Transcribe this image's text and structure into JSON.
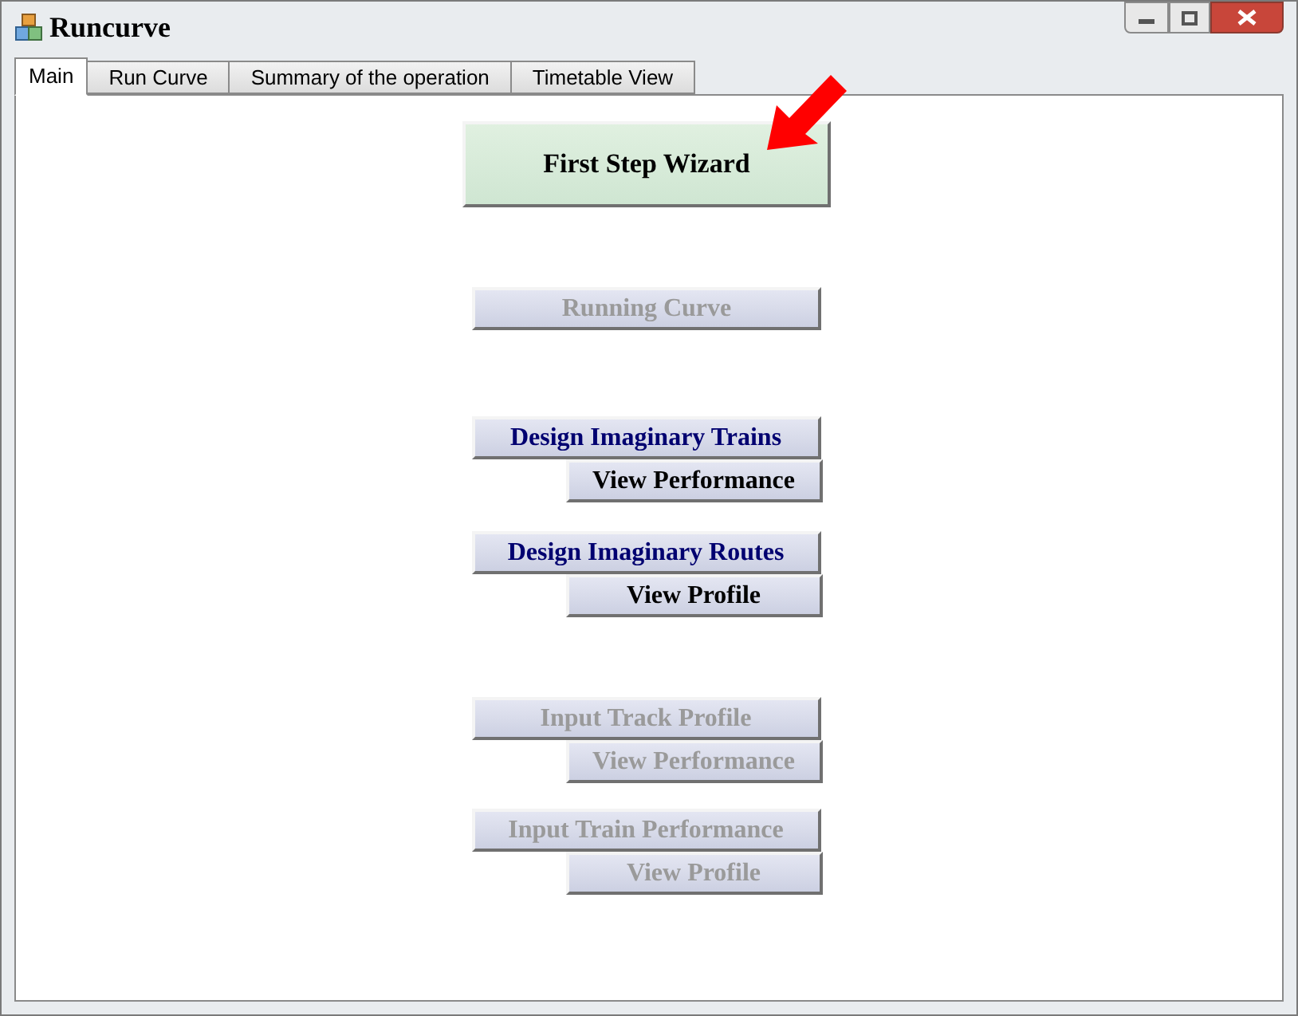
{
  "window": {
    "title": "Runcurve"
  },
  "tabs": [
    {
      "label": "Main",
      "selected": true
    },
    {
      "label": "Run Curve",
      "selected": false
    },
    {
      "label": "Summary of the operation",
      "selected": false
    },
    {
      "label": "Timetable View",
      "selected": false
    }
  ],
  "groups": [
    [
      {
        "label": "First Step Wizard",
        "kind": "wizard",
        "disabled": false
      }
    ],
    [
      {
        "label": "Running Curve",
        "kind": "main",
        "disabled": true
      }
    ],
    [
      {
        "label": "Design Imaginary Trains",
        "kind": "main",
        "disabled": false
      },
      {
        "label": "View Performance",
        "kind": "sub",
        "disabled": false
      }
    ],
    [
      {
        "label": "Design Imaginary Routes",
        "kind": "main",
        "disabled": false
      },
      {
        "label": "View Profile",
        "kind": "sub",
        "disabled": false
      }
    ],
    [
      {
        "label": "Input Track Profile",
        "kind": "main",
        "disabled": true
      },
      {
        "label": "View Performance",
        "kind": "sub",
        "disabled": true
      }
    ],
    [
      {
        "label": "Input Train Performance",
        "kind": "main",
        "disabled": true
      },
      {
        "label": "View Profile",
        "kind": "sub",
        "disabled": true
      }
    ]
  ]
}
